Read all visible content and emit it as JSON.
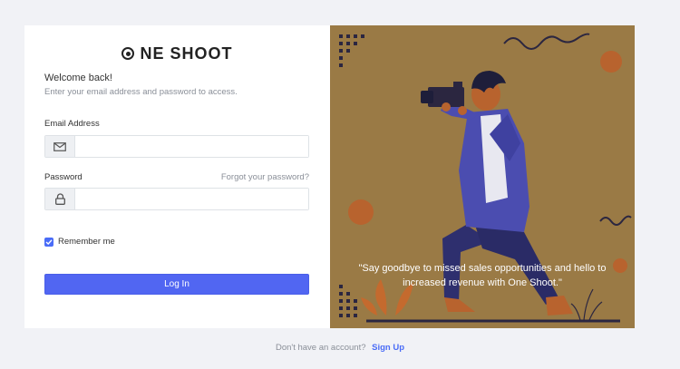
{
  "brand": {
    "logo_text": "NE SHOOT",
    "logo_initial": "O"
  },
  "login": {
    "welcome": "Welcome back!",
    "subtitle": "Enter your email address and password to access.",
    "email_label": "Email Address",
    "email_value": "",
    "password_label": "Password",
    "password_value": "",
    "forgot_link": "Forgot your password?",
    "remember_label": "Remember me",
    "remember_checked": true,
    "login_button": "Log In"
  },
  "illustration": {
    "quote": "\"Say goodbye to missed sales opportunities and hello to increased revenue with One Shoot.\""
  },
  "footer": {
    "text": "Don't have an account?",
    "signup_link": "Sign Up"
  },
  "colors": {
    "accent": "#5166f2",
    "panel": "#9a7a45",
    "background": "#f1f2f6"
  }
}
